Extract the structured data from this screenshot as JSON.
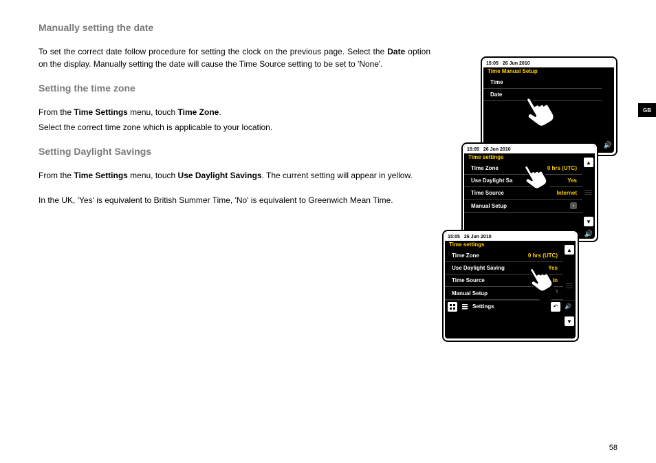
{
  "headings": {
    "h1": "Manually setting the date",
    "h2": "Setting the time zone",
    "h3": "Setting Daylight Savings"
  },
  "paragraphs": {
    "p1a": "To set the correct date follow procedure for setting the clock on the previous page. Select the ",
    "p1b": "Date",
    "p1c": " option on the display. Manually setting the date will cause the Time Source setting to be set to 'None'.",
    "p2a": "From the ",
    "p2b": "Time Settings",
    "p2c": " menu, touch ",
    "p2d": "Time Zone",
    "p2e": ".",
    "p2f": "Select the correct time zone which is applicable to your location.",
    "p3a": "From the ",
    "p3b": "Time Settings",
    "p3c": " menu, touch ",
    "p3d": "Use Daylight Savings",
    "p3e": ". The current setting will appear in yellow.",
    "p4": "In the UK, 'Yes' is equivalent to British Summer Time, 'No' is equivalent to Greenwich Mean Time."
  },
  "page_number": "58",
  "side_tab": "GB",
  "device_common": {
    "time": "15:05",
    "date": "26 Jun 2010",
    "settings_label": "Settings"
  },
  "dev1": {
    "title": "Time Manual Setup",
    "row1": "Time",
    "row2": "Date"
  },
  "dev2": {
    "title": "Time settings",
    "rows": {
      "tz_label": "Time Zone",
      "tz_val": "0 hrs (UTC)",
      "dls_label": "Use Daylight Sa",
      "dls_val": "Yes",
      "src_label": "Time Source",
      "src_val": "Internet",
      "manual_label": "Manual Setup"
    }
  },
  "dev3": {
    "title": "Time settings",
    "rows": {
      "tz_label": "Time Zone",
      "tz_val": "0 hrs (UTC)",
      "dls_label": "Use Daylight Saving",
      "dls_val": "Yes",
      "src_label": "Time Source",
      "src_val": "In",
      "manual_label": "Manual Setup"
    }
  }
}
